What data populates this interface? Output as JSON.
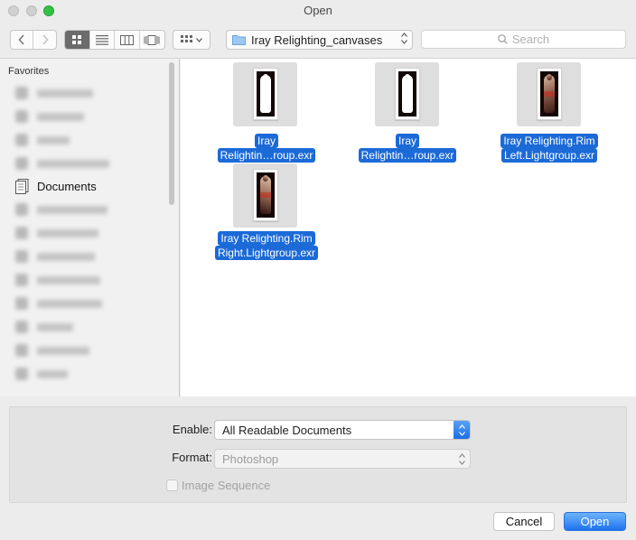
{
  "window": {
    "title": "Open"
  },
  "toolbar": {
    "back_icon": "chevron-left-icon",
    "forward_icon": "chevron-right-icon",
    "view_modes": [
      "icon-view",
      "list-view",
      "column-view",
      "coverflow-view"
    ],
    "active_view": "icon-view",
    "arrange_icon": "arrange-grid-icon",
    "location": "Iray Relighting_canvases",
    "search_placeholder": "Search"
  },
  "sidebar": {
    "heading": "Favorites",
    "visible_item": {
      "label": "Documents",
      "icon": "documents-icon"
    }
  },
  "files": [
    {
      "line1": "Iray",
      "line2": "Relightin…roup.exr",
      "thumb": "white"
    },
    {
      "line1": "Iray",
      "line2": "Relightin…roup.exr",
      "thumb": "white"
    },
    {
      "line1": "Iray Relighting.Rim",
      "line2": "Left.Lightgroup.exr",
      "thumb": "warm"
    },
    {
      "line1": "Iray Relighting.Rim",
      "line2": "Right.Lightgroup.exr",
      "thumb": "warm2"
    }
  ],
  "options": {
    "enable_label": "Enable:",
    "enable_value": "All Readable Documents",
    "format_label": "Format:",
    "format_value": "Photoshop",
    "image_sequence_label": "Image Sequence"
  },
  "buttons": {
    "cancel": "Cancel",
    "open": "Open"
  },
  "colors": {
    "selection": "#1b6ad8",
    "accent": "#1f74f0"
  }
}
